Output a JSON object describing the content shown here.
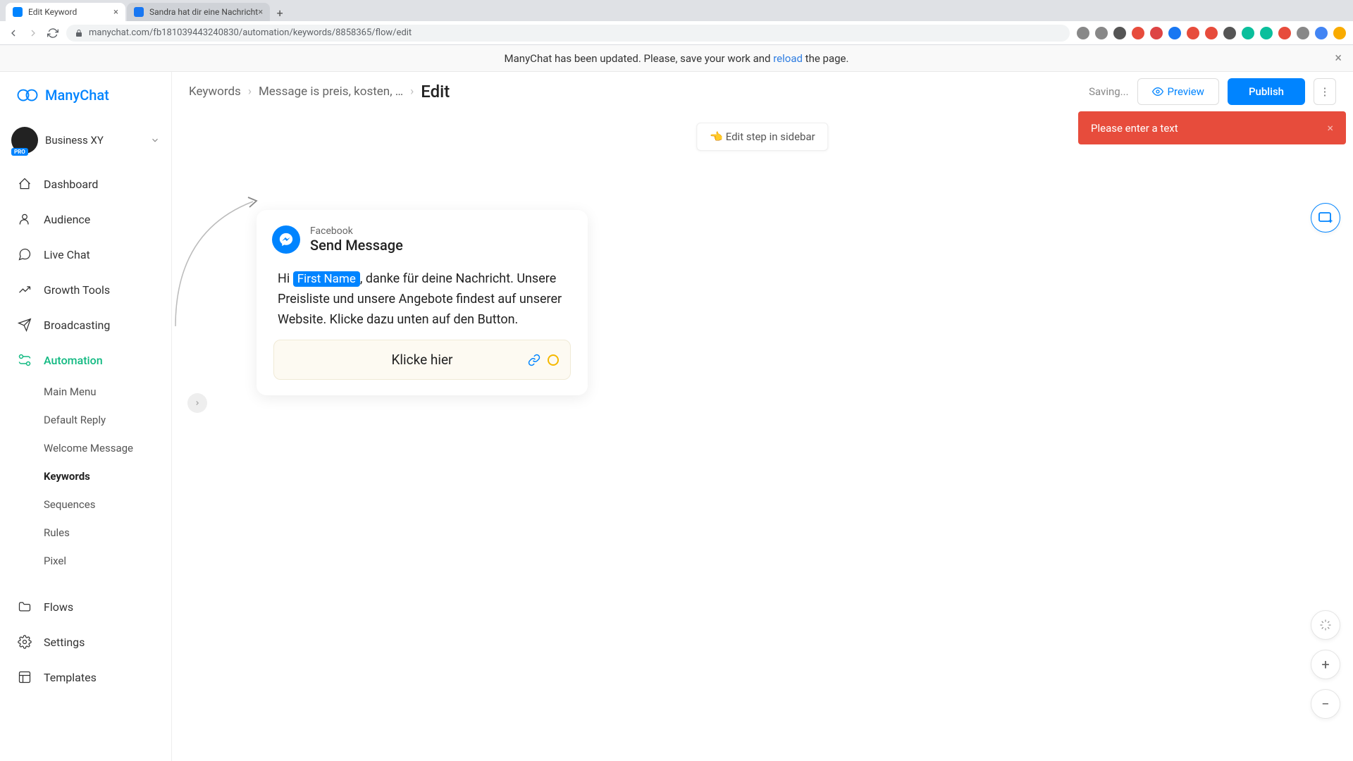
{
  "browser": {
    "tabs": [
      {
        "title": "Edit Keyword",
        "favicon_bg": "#0084ff"
      },
      {
        "title": "Sandra hat dir eine Nachricht",
        "favicon_bg": "#1877f2"
      }
    ],
    "url": "manychat.com/fb181039443240830/automation/keywords/8858365/flow/edit"
  },
  "banner": {
    "text_before": "ManyChat has been updated. Please, save your work and ",
    "link_text": "reload",
    "text_after": " the page."
  },
  "brand": {
    "name": "ManyChat"
  },
  "account": {
    "name": "Business XY",
    "badge": "PRO"
  },
  "sidebar": {
    "items": [
      {
        "label": "Dashboard"
      },
      {
        "label": "Audience"
      },
      {
        "label": "Live Chat"
      },
      {
        "label": "Growth Tools"
      },
      {
        "label": "Broadcasting"
      },
      {
        "label": "Automation"
      }
    ],
    "automation_sub": [
      {
        "label": "Main Menu"
      },
      {
        "label": "Default Reply"
      },
      {
        "label": "Welcome Message"
      },
      {
        "label": "Keywords"
      },
      {
        "label": "Sequences"
      },
      {
        "label": "Rules"
      },
      {
        "label": "Pixel"
      }
    ],
    "bottom": [
      {
        "label": "Flows"
      },
      {
        "label": "Settings"
      },
      {
        "label": "Templates"
      }
    ]
  },
  "topbar": {
    "crumb1": "Keywords",
    "crumb2": "Message is preis, kosten, …",
    "current": "Edit",
    "saving": "Saving...",
    "preview": "Preview",
    "publish": "Publish"
  },
  "hint": {
    "text": "👈 Edit step in sidebar"
  },
  "error": {
    "text": "Please enter a text"
  },
  "node": {
    "platform": "Facebook",
    "title": "Send Message",
    "msg_prefix": "Hi ",
    "msg_var": "First Name",
    "msg_suffix": ", danke für deine Nachricht. Unsere Preisliste und unsere Angebote findest auf unserer Website. Klicke dazu unten auf den Button.",
    "button_label": "Klicke hier"
  }
}
